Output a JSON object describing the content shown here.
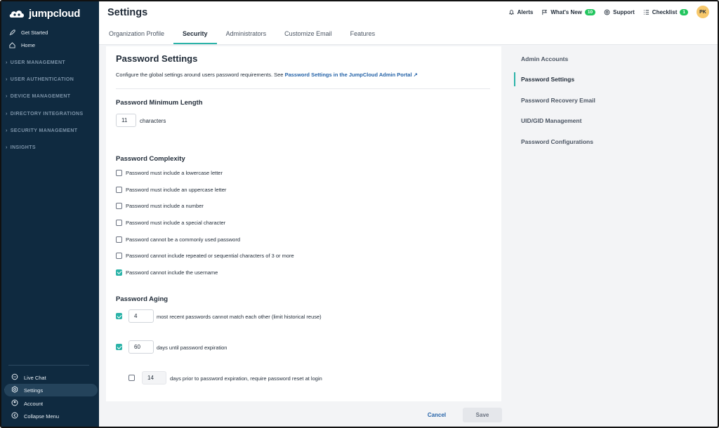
{
  "brand": {
    "name": "jumpcloud"
  },
  "sidebar": {
    "top_items": [
      {
        "label": "Get Started",
        "icon": "rocket-icon"
      },
      {
        "label": "Home",
        "icon": "home-icon"
      }
    ],
    "sections": [
      "USER MANAGEMENT",
      "USER AUTHENTICATION",
      "DEVICE MANAGEMENT",
      "DIRECTORY INTEGRATIONS",
      "SECURITY MANAGEMENT",
      "INSIGHTS"
    ],
    "bottom_items": [
      {
        "label": "Live Chat",
        "icon": "chat-icon"
      },
      {
        "label": "Settings",
        "icon": "gear-icon",
        "active": true
      },
      {
        "label": "Account",
        "icon": "account-icon"
      },
      {
        "label": "Collapse Menu",
        "icon": "collapse-icon"
      }
    ]
  },
  "header": {
    "title": "Settings",
    "alerts": "Alerts",
    "whats_new": "What's New",
    "whats_new_count": "10",
    "support": "Support",
    "checklist": "Checklist",
    "checklist_count": "1",
    "avatar_initials": "PK",
    "tabs": [
      {
        "label": "Organization Profile",
        "active": false
      },
      {
        "label": "Security",
        "active": true
      },
      {
        "label": "Administrators",
        "active": false
      },
      {
        "label": "Customize Email",
        "active": false
      },
      {
        "label": "Features",
        "active": false
      }
    ]
  },
  "password_settings": {
    "title": "Password Settings",
    "description": "Configure the global settings around users password requirements. See ",
    "link_text": "Password Settings in the JumpCloud Admin Portal ↗",
    "min_length": {
      "title": "Password Minimum Length",
      "value": "11",
      "unit": "characters"
    },
    "complexity": {
      "title": "Password Complexity",
      "options": [
        {
          "label": "Password must include a lowercase letter",
          "checked": false
        },
        {
          "label": "Password must include an uppercase letter",
          "checked": false
        },
        {
          "label": "Password must include a number",
          "checked": false
        },
        {
          "label": "Password must include a special character",
          "checked": false
        },
        {
          "label": "Password cannot be a commonly used password",
          "checked": false
        },
        {
          "label": "Password cannot include repeated or sequential characters of 3 or more",
          "checked": false
        },
        {
          "label": "Password cannot include the username",
          "checked": true
        }
      ]
    },
    "aging": {
      "title": "Password Aging",
      "history": {
        "checked": true,
        "value": "4",
        "label": "most recent passwords cannot match each other (limit historical reuse)"
      },
      "expiration": {
        "checked": true,
        "value": "60",
        "label": "days until password expiration"
      },
      "reset_prior": {
        "checked": false,
        "value": "14",
        "label": "days prior to password expiration, require password reset at login"
      }
    }
  },
  "right_nav": [
    {
      "label": "Admin Accounts",
      "active": false
    },
    {
      "label": "Password Settings",
      "active": true
    },
    {
      "label": "Password Recovery Email",
      "active": false
    },
    {
      "label": "UID/GID Management",
      "active": false
    },
    {
      "label": "Password Configurations",
      "active": false
    }
  ],
  "footer": {
    "cancel": "Cancel",
    "save": "Save"
  },
  "colors": {
    "sidebar": "#0f2a40",
    "accent": "#2bb3a8",
    "link": "#2563a8",
    "badge": "#22c55e",
    "avatar": "#f7c86b"
  }
}
